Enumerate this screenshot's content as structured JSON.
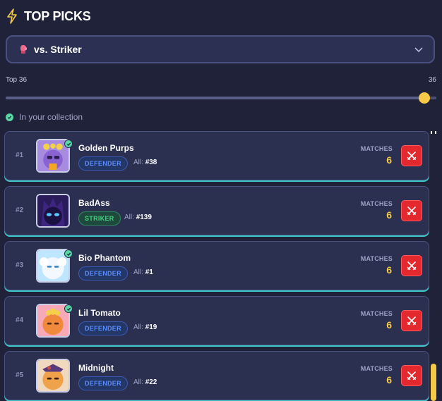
{
  "header": {
    "title": "TOP PICKS",
    "icon": "lightning-bolt-icon"
  },
  "selector": {
    "icon": "boxing-glove-icon",
    "label": "vs. Striker"
  },
  "range": {
    "label": "Top 36",
    "value_text": "36",
    "value": 36,
    "max": 36
  },
  "legend": {
    "label": "In your collection",
    "color": "#58d6a3"
  },
  "colors": {
    "accent": "#f7c948",
    "defender": "#5b8dff",
    "striker": "#3ed27f",
    "action": "#e3292e"
  },
  "cards": [
    {
      "rank": "#1",
      "name": "Golden Purps",
      "role": "DEFENDER",
      "all_label": "All:",
      "all_rank": "#38",
      "matches_label": "MATCHES",
      "matches": "6",
      "in_collection": true
    },
    {
      "rank": "#2",
      "name": "BadAss",
      "role": "STRIKER",
      "all_label": "All:",
      "all_rank": "#139",
      "matches_label": "MATCHES",
      "matches": "6",
      "in_collection": false
    },
    {
      "rank": "#3",
      "name": "Bio Phantom",
      "role": "DEFENDER",
      "all_label": "All:",
      "all_rank": "#1",
      "matches_label": "MATCHES",
      "matches": "6",
      "in_collection": true
    },
    {
      "rank": "#4",
      "name": "Lil Tomato",
      "role": "DEFENDER",
      "all_label": "All:",
      "all_rank": "#19",
      "matches_label": "MATCHES",
      "matches": "6",
      "in_collection": true
    },
    {
      "rank": "#5",
      "name": "Midnight",
      "role": "DEFENDER",
      "all_label": "All:",
      "all_rank": "#22",
      "matches_label": "MATCHES",
      "matches": "6",
      "in_collection": false
    }
  ]
}
